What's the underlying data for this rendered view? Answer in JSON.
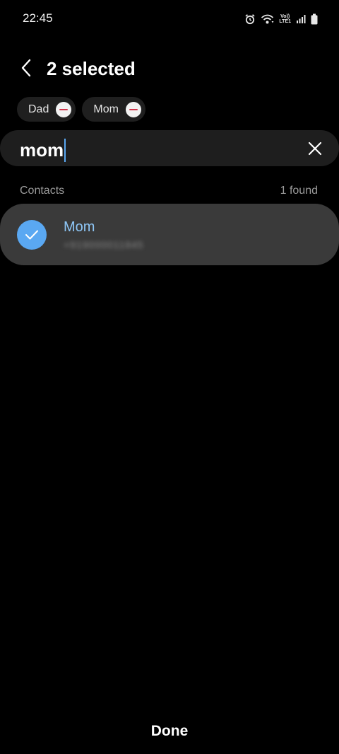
{
  "status_bar": {
    "time": "22:45",
    "icons": [
      "alarm-icon",
      "wifi-icon",
      "volte-icon",
      "signal-icon",
      "battery-icon"
    ],
    "volte_line1": "Vo))",
    "volte_line2": "LTE1"
  },
  "header": {
    "back_icon": "chevron-left-icon",
    "title": "2 selected"
  },
  "chips": [
    {
      "label": "Dad",
      "icon": "remove-icon"
    },
    {
      "label": "Mom",
      "icon": "remove-icon"
    }
  ],
  "search": {
    "value": "mom",
    "clear_icon": "close-icon"
  },
  "results": {
    "section_label": "Contacts",
    "count_label": "1 found",
    "items": [
      {
        "name": "Mom",
        "number": "+919000011845",
        "selected": true,
        "icon": "check-icon"
      }
    ]
  },
  "footer": {
    "done_label": "Done"
  },
  "colors": {
    "background": "#000000",
    "accent": "#5aa8f2",
    "selected_name": "#8ec6f6",
    "row_background": "#3a3a3a",
    "remove_minus": "#d0344a"
  }
}
